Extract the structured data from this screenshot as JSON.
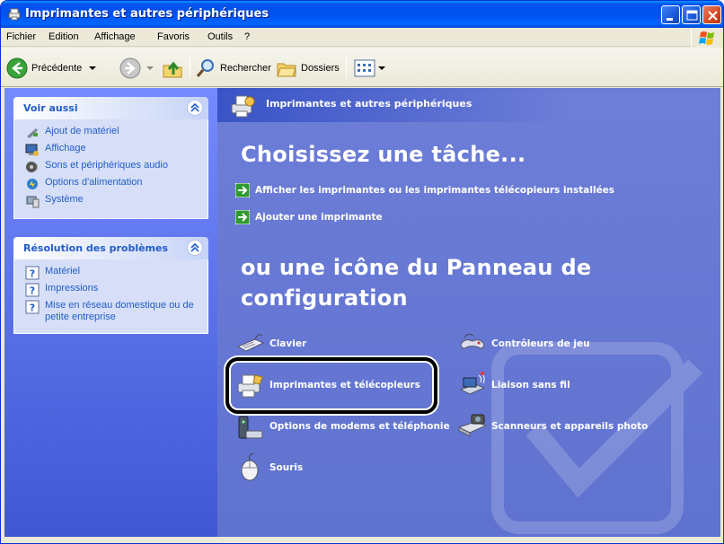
{
  "window": {
    "title": "Imprimantes et autres périphériques"
  },
  "menu": {
    "items": [
      {
        "label": "Fichier"
      },
      {
        "label": "Edition"
      },
      {
        "label": "Affichage"
      },
      {
        "label": "Favoris"
      },
      {
        "label": "Outils"
      },
      {
        "label": "?"
      }
    ]
  },
  "toolbar": {
    "back_label": "Précédente",
    "search_label": "Rechercher",
    "folders_label": "Dossiers"
  },
  "sidebar": {
    "see_also": {
      "title": "Voir aussi",
      "items": [
        {
          "label": "Ajout de matériel",
          "icon": "hardware-icon"
        },
        {
          "label": "Affichage",
          "icon": "display-icon"
        },
        {
          "label": "Sons et périphériques audio",
          "icon": "sound-icon"
        },
        {
          "label": "Options d'alimentation",
          "icon": "power-icon"
        },
        {
          "label": "Système",
          "icon": "system-icon"
        }
      ]
    },
    "troubleshoot": {
      "title": "Résolution des problèmes",
      "items": [
        {
          "label": "Matériel",
          "icon": "help-icon"
        },
        {
          "label": "Impressions",
          "icon": "help-icon"
        },
        {
          "label": "Mise en réseau domestique ou de petite entreprise",
          "icon": "help-icon"
        }
      ]
    }
  },
  "main": {
    "header_title": "Imprimantes et autres périphériques",
    "task_heading": "Choisissez une tâche...",
    "tasks": [
      {
        "label": "Afficher les imprimantes ou les imprimantes télécopieurs installées"
      },
      {
        "label": "Ajouter une imprimante"
      }
    ],
    "cp_heading_line1": "ou une icône du Panneau de",
    "cp_heading_line2": "configuration",
    "cp_items": [
      {
        "label": "Clavier",
        "icon": "keyboard-icon"
      },
      {
        "label": "Contrôleurs de jeu",
        "icon": "gamepad-icon"
      },
      {
        "label": "Imprimantes et télécopieurs",
        "icon": "printer-icon"
      },
      {
        "label": "Liaison sans fil",
        "icon": "wireless-icon"
      },
      {
        "label": "Options de modems et téléphonie",
        "icon": "modem-icon"
      },
      {
        "label": "Scanneurs et appareils photo",
        "icon": "scanner-icon"
      },
      {
        "label": "Souris",
        "icon": "mouse-icon"
      }
    ]
  }
}
